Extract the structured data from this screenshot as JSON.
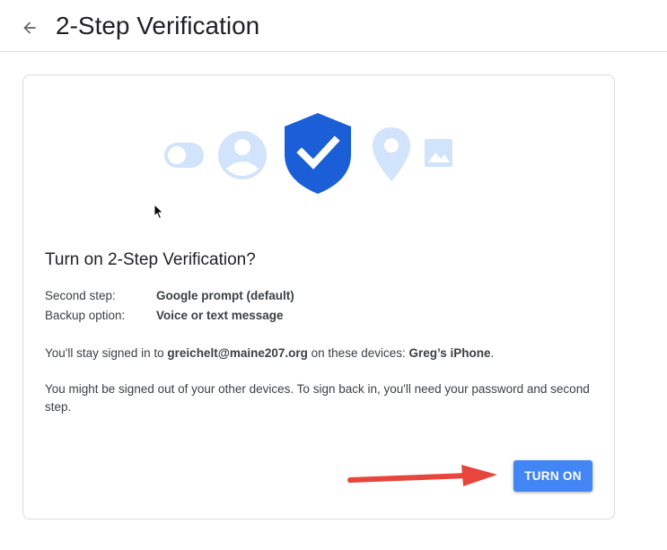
{
  "header": {
    "title": "2-Step Verification"
  },
  "card": {
    "heading": "Turn on 2-Step Verification?",
    "details": [
      {
        "label": "Second step:",
        "value": "Google prompt (default)"
      },
      {
        "label": "Backup option:",
        "value": "Voice or text message"
      }
    ],
    "signed_in": {
      "prefix": "You'll stay signed in to ",
      "email": "greichelt@maine207.org",
      "middle": " on these devices: ",
      "device": "Greg’s iPhone",
      "suffix": "."
    },
    "signout_note": "You might be signed out of your other devices. To sign back in, you'll need your password and second step.",
    "button_label": "TURN ON"
  },
  "colors": {
    "accent": "#4285f4",
    "shield": "#1a5fd8",
    "illustration_light": "#d2e3fc",
    "arrow": "#e8453c"
  },
  "icons": [
    "back-arrow-icon",
    "toggle-icon",
    "account-circle-icon",
    "shield-check-icon",
    "location-pin-icon",
    "image-icon",
    "mouse-cursor-icon"
  ]
}
